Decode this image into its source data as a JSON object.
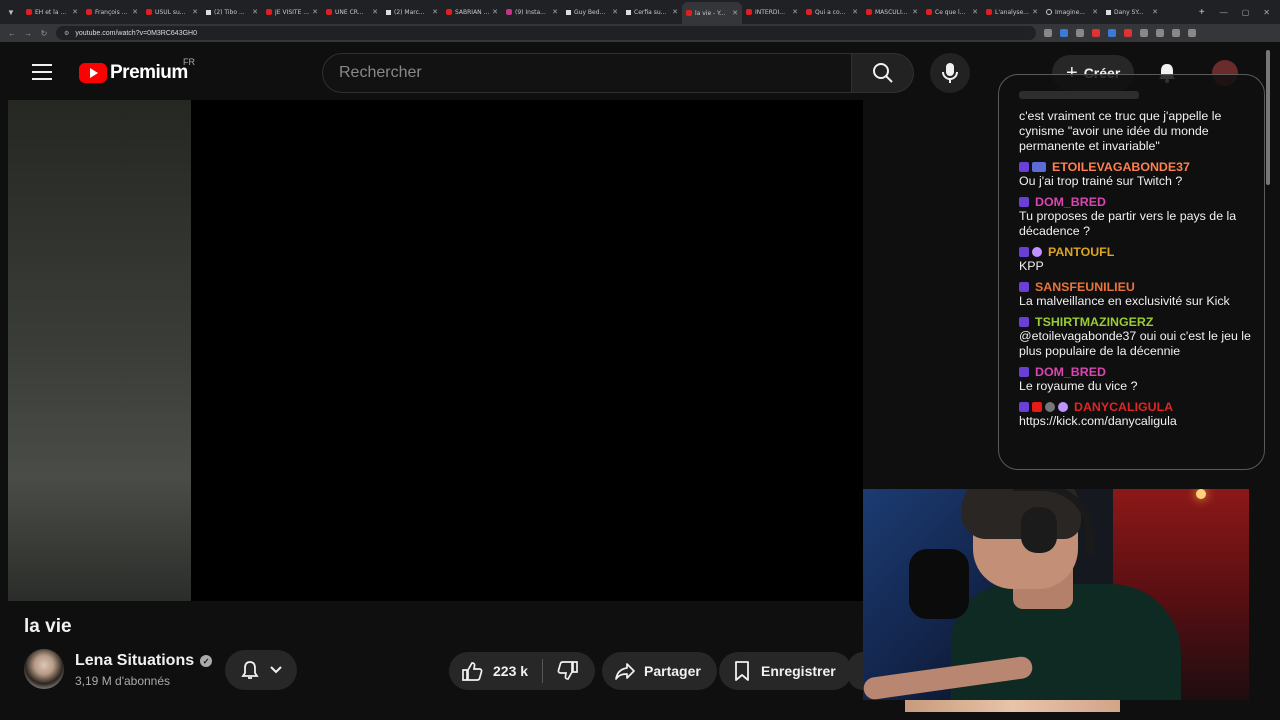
{
  "browser": {
    "tabs": [
      {
        "title": "EH et la ...",
        "fav": "yt"
      },
      {
        "title": "François ...",
        "fav": "yt"
      },
      {
        "title": "USUL su...",
        "fav": "yt"
      },
      {
        "title": "(2) Tibo ...",
        "fav": "x"
      },
      {
        "title": "JE VISITE ...",
        "fav": "yt"
      },
      {
        "title": "UNE CR...",
        "fav": "yt"
      },
      {
        "title": "(2) Marc...",
        "fav": "x"
      },
      {
        "title": "SABRIAN ...",
        "fav": "yt"
      },
      {
        "title": "(9) Insta...",
        "fav": "ig"
      },
      {
        "title": "Guy Bed...",
        "fav": "x"
      },
      {
        "title": "Cerfia su...",
        "fav": "x"
      },
      {
        "title": "la vie - Y...",
        "fav": "yt",
        "active": true
      },
      {
        "title": "INTERDI...",
        "fav": "yt"
      },
      {
        "title": "Qui a co...",
        "fav": "yt"
      },
      {
        "title": "MASCULI...",
        "fav": "yt"
      },
      {
        "title": "Ce que l...",
        "fav": "yt"
      },
      {
        "title": "L'analyse...",
        "fav": "yt"
      },
      {
        "title": "Imagine...",
        "fav": "g"
      },
      {
        "title": "Dany SY...",
        "fav": "x"
      }
    ],
    "url": "youtube.com/watch?v=0M3RC643GH0"
  },
  "header": {
    "logo_text": "Premium",
    "region": "FR",
    "search_placeholder": "Rechercher",
    "create_label": "Créer"
  },
  "video": {
    "title": "la vie",
    "channel_name": "Lena Situations",
    "subscribers": "3,19 M d'abonnés",
    "likes": "223 k",
    "share_label": "Partager",
    "save_label": "Enregistrer"
  },
  "chat": {
    "first_text": "c'est vraiment ce truc que j'appelle le cynisme \"avoir une idée du monde permanente et invariable\"",
    "messages": [
      {
        "user": "ETOILEVAGABONDE37",
        "color": "#ff7f50",
        "text": "Ou j'ai trop trainé sur Twitch ?",
        "badges": [
          "sub",
          "alt"
        ]
      },
      {
        "user": "DOM_BRED",
        "color": "#d946b0",
        "text": "Tu proposes de partir vers le pays de la décadence ?",
        "badges": [
          "sub"
        ]
      },
      {
        "user": "PANTOUFL",
        "color": "#daa520",
        "text": "KPP",
        "badges": [
          "sub",
          "v"
        ]
      },
      {
        "user": "SANSFEUNILIEU",
        "color": "#e8743b",
        "text": "La malveillance en exclusivité sur Kick",
        "badges": [
          "sub"
        ]
      },
      {
        "user": "TSHIRTMAZINGERZ",
        "color": "#9acd32",
        "text": "@etoilevagabonde37 oui oui c'est le jeu le plus populaire de la décennie",
        "badges": [
          "sub"
        ]
      },
      {
        "user": "DOM_BRED",
        "color": "#d946b0",
        "text": "Le royaume du vice ?",
        "badges": [
          "sub"
        ]
      },
      {
        "user": "DANYCALIGULA",
        "color": "#e02525",
        "text": "https://kick.com/danycaligula",
        "badges": [
          "sub",
          "vid",
          "gr",
          "v"
        ]
      }
    ]
  }
}
